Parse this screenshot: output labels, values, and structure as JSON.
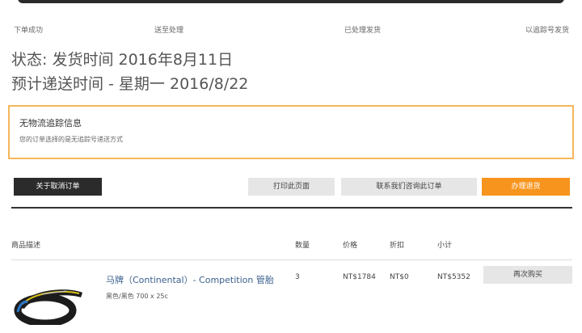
{
  "progress": {
    "steps": [
      "下单成功",
      "送至处理",
      "已处理发货",
      "以追踪号发货"
    ]
  },
  "status": {
    "shipped_line": "状态: 发货时间 2016年8月11日",
    "delivery_line": "预计递送时间 - 星期一 2016/8/22"
  },
  "tracking": {
    "title": "无物流追踪信息",
    "description": "您的订单选择的是无追踪号递送方式"
  },
  "actions": {
    "cancel_label": "关于取消订单",
    "print_label": "打印此页面",
    "contact_label": "联系我们咨询此订单",
    "return_label": "办理退货"
  },
  "table": {
    "headers": [
      "商品描述",
      "数量",
      "价格",
      "折扣",
      "小计"
    ],
    "rows": [
      {
        "name": "马牌（Continental）- Competition 管胎",
        "variant": "黑色/黑色 700 x 25c",
        "qty": "3",
        "price": "NT$1784",
        "discount": "NT$0",
        "subtotal": "NT$5352",
        "rebuy_label": "再次购买"
      }
    ]
  },
  "colors": {
    "accent_orange": "#f7941d",
    "tracking_border": "#f5b75a",
    "dark_button": "#2b2b2b",
    "link_blue": "#3a5f8c"
  }
}
